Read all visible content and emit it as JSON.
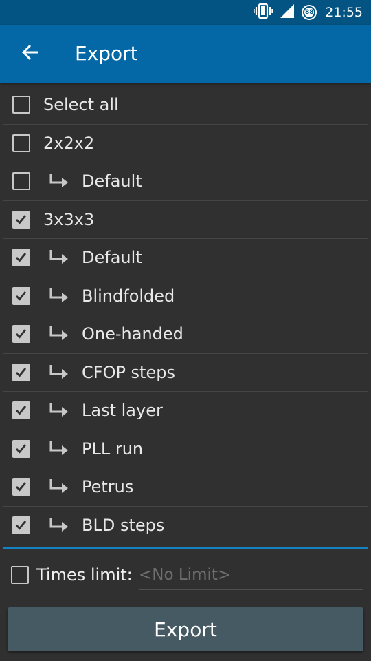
{
  "status_bar": {
    "time": "21:55",
    "battery_level": "88",
    "icons": [
      "vibrate-icon",
      "signal-icon",
      "battery-icon"
    ]
  },
  "toolbar": {
    "back_icon": "arrow-left-icon",
    "title": "Export"
  },
  "items": [
    {
      "label": "Select all",
      "checked": false,
      "indent": false
    },
    {
      "label": "2x2x2",
      "checked": false,
      "indent": false
    },
    {
      "label": "Default",
      "checked": false,
      "indent": true
    },
    {
      "label": "3x3x3",
      "checked": true,
      "indent": false
    },
    {
      "label": "Default",
      "checked": true,
      "indent": true
    },
    {
      "label": "Blindfolded",
      "checked": true,
      "indent": true
    },
    {
      "label": "One-handed",
      "checked": true,
      "indent": true
    },
    {
      "label": "CFOP steps",
      "checked": true,
      "indent": true
    },
    {
      "label": "Last layer",
      "checked": true,
      "indent": true
    },
    {
      "label": "PLL run",
      "checked": true,
      "indent": true
    },
    {
      "label": "Petrus",
      "checked": true,
      "indent": true
    },
    {
      "label": "BLD steps",
      "checked": true,
      "indent": true
    }
  ],
  "times_limit": {
    "label": "Times limit:",
    "checked": false,
    "placeholder": "<No Limit>",
    "value": ""
  },
  "export_button": {
    "label": "Export"
  },
  "colors": {
    "status_bar": "#045483",
    "toolbar": "#0568a6",
    "background": "#303030",
    "accent_divider": "#1483c4",
    "button": "#455a63"
  }
}
